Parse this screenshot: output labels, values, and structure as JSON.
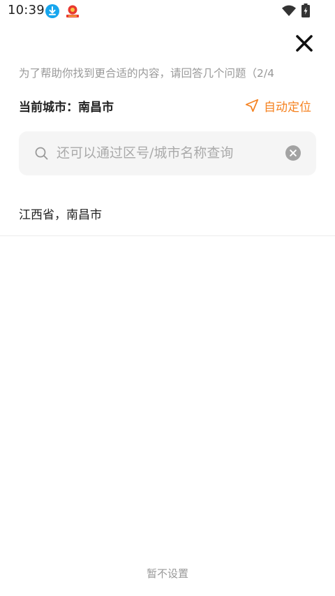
{
  "status_bar": {
    "time": "10:39",
    "icons": [
      "download-icon",
      "app-notification-icon",
      "wifi-icon",
      "battery-charging-icon"
    ]
  },
  "header": {
    "close_icon": "close-icon"
  },
  "question": {
    "progress_text": "为了帮助你找到更合适的内容，请回答几个问题（2/4"
  },
  "location": {
    "current_city_label": "当前城市：南昌市",
    "auto_locate_label": "自动定位",
    "auto_locate_icon": "navigation-arrow-icon",
    "accent_color": "#f58220"
  },
  "search": {
    "placeholder": "还可以通过区号/城市名称查询",
    "value": "",
    "search_icon": "search-icon",
    "clear_icon": "clear-circle-icon"
  },
  "results": [
    {
      "label": "江西省，南昌市"
    }
  ],
  "footer": {
    "skip_label": "暂不设置"
  }
}
